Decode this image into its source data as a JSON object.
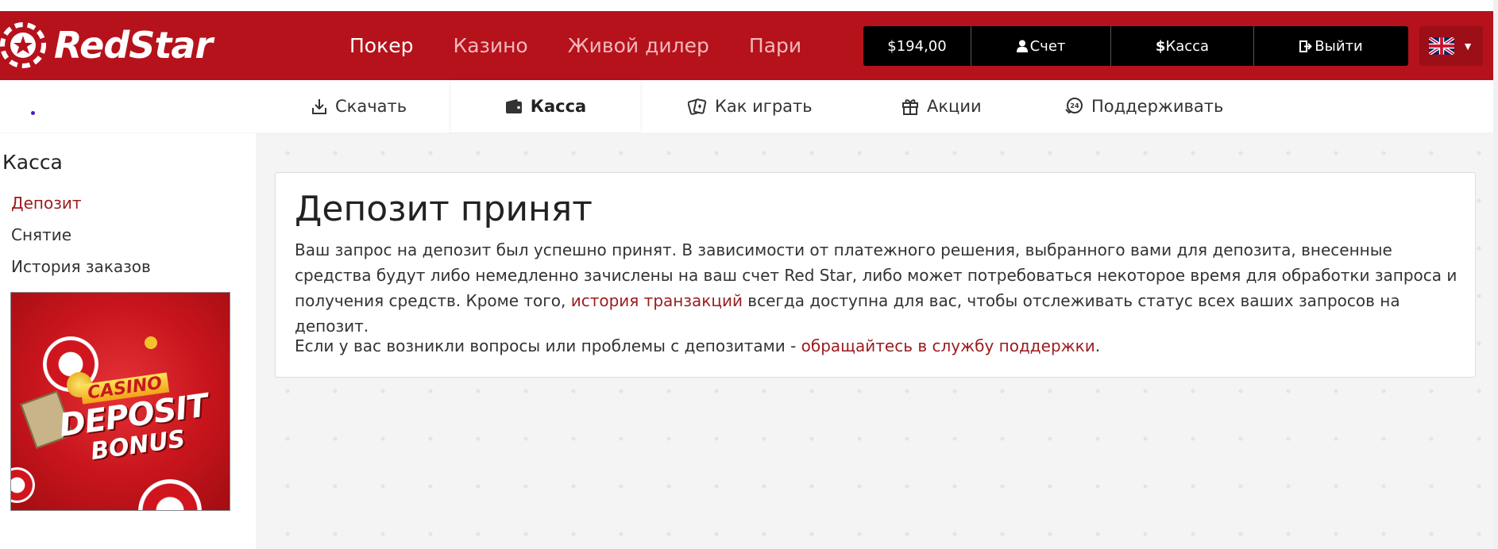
{
  "header": {
    "logo_text": "RedStar",
    "nav": [
      {
        "label": "Покер",
        "active": true
      },
      {
        "label": "Казино",
        "active": false
      },
      {
        "label": "Живой дилер",
        "active": false
      },
      {
        "label": "Пари",
        "active": false
      }
    ],
    "balance": "$194,00",
    "account_label": "Счет",
    "cashier_label": "Касса",
    "cashier_prefix": "$",
    "logout_label": "Выйти",
    "language": "English (UK flag)"
  },
  "subnav": [
    {
      "label": "Скачать",
      "icon": "download-icon"
    },
    {
      "label": "Касса",
      "icon": "wallet-icon",
      "active": true
    },
    {
      "label": "Как играть",
      "icon": "cards-icon"
    },
    {
      "label": "Акции",
      "icon": "gift-icon"
    },
    {
      "label": "Поддерживать",
      "icon": "support-24-icon"
    }
  ],
  "sidebar": {
    "title": "Касса",
    "links": [
      {
        "label": "Депозит",
        "active": true
      },
      {
        "label": "Снятие",
        "active": false
      },
      {
        "label": "История заказов",
        "active": false
      }
    ],
    "banner": {
      "line1": "CASINO",
      "line2": "DEPOSIT",
      "line3": "BONUS"
    }
  },
  "main": {
    "title": "Депозит принят",
    "para1_before": "Ваш запрос на депозит был успешно принят. В зависимости от платежного решения, выбранного вами для депозита, внесенные средства будут либо немедленно зачислены на ваш счет Red Star, либо может потребоваться некоторое время для обработки запроса и получения средств. Кроме того, ",
    "para1_link": "история транзакций",
    "para1_after": " всегда доступна для вас, чтобы отслеживать статус всех ваших запросов на депозит.",
    "para2_before": "Если у вас возникли вопросы или проблемы с депозитами - ",
    "para2_link": "обращайтесь в службу поддержки",
    "para2_after": "."
  },
  "colors": {
    "brand_red": "#b5121b",
    "link_red": "#9b1b1f",
    "black": "#000000"
  }
}
